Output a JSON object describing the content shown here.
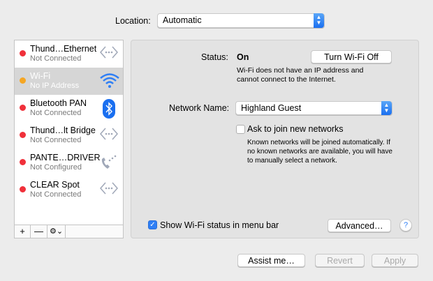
{
  "location": {
    "label": "Location:",
    "value": "Automatic"
  },
  "services": [
    {
      "name": "Thund…Ethernet",
      "status": "Not Connected",
      "dot": "#f0303a",
      "icon": "ethernet-icon",
      "selected": false
    },
    {
      "name": "Wi-Fi",
      "status": "No IP Address",
      "dot": "#f5a623",
      "icon": "wifi-icon",
      "selected": true
    },
    {
      "name": "Bluetooth PAN",
      "status": "Not Connected",
      "dot": "#f0303a",
      "icon": "bluetooth-icon",
      "selected": false
    },
    {
      "name": "Thund…lt Bridge",
      "status": "Not Connected",
      "dot": "#f0303a",
      "icon": "ethernet-icon",
      "selected": false
    },
    {
      "name": "PANTE…DRIVER",
      "status": "Not Configured",
      "dot": "#f0303a",
      "icon": "phone-icon",
      "selected": false
    },
    {
      "name": "CLEAR Spot",
      "status": "Not Connected",
      "dot": "#f0303a",
      "icon": "ethernet-icon",
      "selected": false
    }
  ],
  "toolbar": {
    "add": "+",
    "remove": "—",
    "gear": "⚙⌄"
  },
  "detail": {
    "status_label": "Status:",
    "status_value": "On",
    "turn_off": "Turn Wi-Fi Off",
    "status_desc1": "Wi-Fi does not have an IP address and",
    "status_desc2": "cannot connect to the Internet.",
    "network_label": "Network Name:",
    "network_value": "Highland Guest",
    "ask_label": "Ask to join new networks",
    "ask_checked": false,
    "ask_desc1": "Known networks will be joined automatically. If",
    "ask_desc2": "no known networks are available, you will have",
    "ask_desc3": "to manually select a network.",
    "show_status_label": "Show Wi-Fi status in menu bar",
    "show_status_checked": true,
    "advanced": "Advanced…",
    "help": "?"
  },
  "footer": {
    "assist": "Assist me…",
    "revert": "Revert",
    "apply": "Apply"
  },
  "colors": {
    "accent": "#2f7ff5"
  }
}
